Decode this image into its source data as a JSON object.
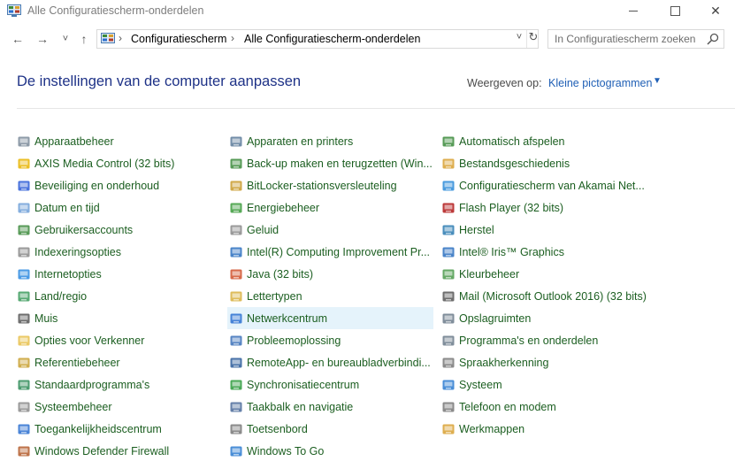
{
  "window": {
    "title": "Alle Configuratiescherm-onderdelen",
    "minimize": "—",
    "maximize": "☐",
    "close": "✕"
  },
  "nav": {
    "back": "←",
    "forward": "→",
    "recent": "˅",
    "up": "↑",
    "breadcrumbs": [
      "Configuratiescherm",
      "Alle Configuratiescherm-onderdelen"
    ],
    "dropdown": "˅",
    "refresh": "↻",
    "search_placeholder": "In Configuratiescherm zoeken"
  },
  "header": {
    "title": "De instellingen van de computer aanpassen",
    "view_label": "Weergeven op:",
    "view_value": "Kleine pictogrammen"
  },
  "columns": [
    [
      {
        "label": "Apparaatbeheer",
        "icon": "device-manager-icon",
        "color": "#7a8a99"
      },
      {
        "label": "AXIS Media Control (32 bits)",
        "icon": "axis-icon",
        "color": "#e8b400"
      },
      {
        "label": "Beveiliging en onderhoud",
        "icon": "flag-icon",
        "color": "#2a5bd7"
      },
      {
        "label": "Datum en tijd",
        "icon": "clock-icon",
        "color": "#6fa0d8"
      },
      {
        "label": "Gebruikersaccounts",
        "icon": "users-icon",
        "color": "#3c8a3c"
      },
      {
        "label": "Indexeringsopties",
        "icon": "index-icon",
        "color": "#8a8a8a"
      },
      {
        "label": "Internetopties",
        "icon": "globe-icon",
        "color": "#2b8ae0"
      },
      {
        "label": "Land/regio",
        "icon": "region-icon",
        "color": "#3a9a5a"
      },
      {
        "label": "Muis",
        "icon": "mouse-icon",
        "color": "#555555"
      },
      {
        "label": "Opties voor Verkenner",
        "icon": "folder-options-icon",
        "color": "#e8c04a"
      },
      {
        "label": "Referentiebeheer",
        "icon": "credential-icon",
        "color": "#c8a030"
      },
      {
        "label": "Standaardprogramma's",
        "icon": "default-programs-icon",
        "color": "#2e8b57"
      },
      {
        "label": "Systeembeheer",
        "icon": "admin-tools-icon",
        "color": "#8a8a8a"
      },
      {
        "label": "Toegankelijkheidscentrum",
        "icon": "accessibility-icon",
        "color": "#2a6fd0"
      },
      {
        "label": "Windows Defender Firewall",
        "icon": "firewall-icon",
        "color": "#b35a2a"
      }
    ],
    [
      {
        "label": "Apparaten en printers",
        "icon": "printer-icon",
        "color": "#5a7a9a"
      },
      {
        "label": "Back-up maken en terugzetten (Win...",
        "icon": "backup-icon",
        "color": "#3a8a3a"
      },
      {
        "label": "BitLocker-stationsversleuteling",
        "icon": "bitlocker-icon",
        "color": "#c89a2a"
      },
      {
        "label": "Energiebeheer",
        "icon": "power-icon",
        "color": "#3a9a3a"
      },
      {
        "label": "Geluid",
        "icon": "speaker-icon",
        "color": "#888888"
      },
      {
        "label": "Intel(R) Computing Improvement Pr...",
        "icon": "intel-icon",
        "color": "#2a6fc0"
      },
      {
        "label": "Java (32 bits)",
        "icon": "java-icon",
        "color": "#d0502a"
      },
      {
        "label": "Lettertypen",
        "icon": "fonts-icon",
        "color": "#d8b040"
      },
      {
        "label": "Netwerkcentrum",
        "icon": "network-icon",
        "color": "#2a6fd0"
      },
      {
        "label": "Probleemoplossing",
        "icon": "troubleshoot-icon",
        "color": "#3a70b8"
      },
      {
        "label": "RemoteApp- en bureaubladverbindi...",
        "icon": "remote-icon",
        "color": "#2a5a9a"
      },
      {
        "label": "Synchronisatiecentrum",
        "icon": "sync-icon",
        "color": "#2a9a3a"
      },
      {
        "label": "Taakbalk en navigatie",
        "icon": "taskbar-icon",
        "color": "#4a6a9a"
      },
      {
        "label": "Toetsenbord",
        "icon": "keyboard-icon",
        "color": "#777777"
      },
      {
        "label": "Windows To Go",
        "icon": "windows-to-go-icon",
        "color": "#2a7ad0"
      }
    ],
    [
      {
        "label": "Automatisch afspelen",
        "icon": "autoplay-icon",
        "color": "#3a8a3a"
      },
      {
        "label": "Bestandsgeschiedenis",
        "icon": "file-history-icon",
        "color": "#d8a030"
      },
      {
        "label": "Configuratiescherm van Akamai Net...",
        "icon": "akamai-icon",
        "color": "#2a8ad8"
      },
      {
        "label": "Flash Player (32 bits)",
        "icon": "flash-icon",
        "color": "#b01818"
      },
      {
        "label": "Herstel",
        "icon": "recovery-icon",
        "color": "#2a7ab0"
      },
      {
        "label": "Intel® Iris™ Graphics",
        "icon": "intel-graphics-icon",
        "color": "#2a6fc0"
      },
      {
        "label": "Kleurbeheer",
        "icon": "color-management-icon",
        "color": "#4a9a4a"
      },
      {
        "label": "Mail (Microsoft Outlook 2016) (32 bits)",
        "icon": "mail-icon",
        "color": "#555555"
      },
      {
        "label": "Opslagruimten",
        "icon": "storage-icon",
        "color": "#6a7a8a"
      },
      {
        "label": "Programma's en onderdelen",
        "icon": "programs-icon",
        "color": "#6a7a8a"
      },
      {
        "label": "Spraakherkenning",
        "icon": "microphone-icon",
        "color": "#777777"
      },
      {
        "label": "Systeem",
        "icon": "system-icon",
        "color": "#2a7ad0"
      },
      {
        "label": "Telefoon en modem",
        "icon": "phone-icon",
        "color": "#777777"
      },
      {
        "label": "Werkmappen",
        "icon": "work-folders-icon",
        "color": "#d8a030"
      }
    ]
  ],
  "highlighted": "Netwerkcentrum"
}
